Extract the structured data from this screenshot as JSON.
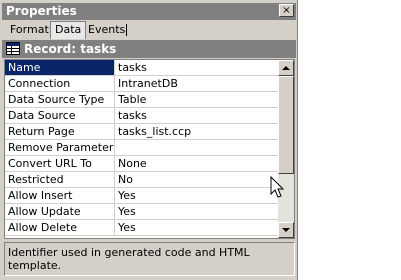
{
  "window": {
    "title": "Properties",
    "close_glyph": "×"
  },
  "tabs": [
    {
      "label": "Format",
      "active": false
    },
    {
      "label": "Data",
      "active": true
    },
    {
      "label": "Events",
      "active": false
    }
  ],
  "record": {
    "title": "Record: tasks",
    "icon": "record-grid-icon"
  },
  "properties": [
    {
      "name": "Name",
      "value": "tasks",
      "selected": true
    },
    {
      "name": "Connection",
      "value": "IntranetDB"
    },
    {
      "name": "Data Source Type",
      "value": "Table"
    },
    {
      "name": "Data Source",
      "value": "tasks"
    },
    {
      "name": "Return Page",
      "value": "tasks_list.ccp"
    },
    {
      "name": "Remove Parameters",
      "value": ""
    },
    {
      "name": "Convert URL To",
      "value": "None"
    },
    {
      "name": "Restricted",
      "value": "No"
    },
    {
      "name": "Allow Insert",
      "value": "Yes"
    },
    {
      "name": "Allow Update",
      "value": "Yes"
    },
    {
      "name": "Allow Delete",
      "value": "Yes"
    }
  ],
  "description": "Identifier used in generated code and HTML template.",
  "colors": {
    "selection": "#0a246a",
    "chrome": "#d4d0c8",
    "header": "#808080"
  }
}
